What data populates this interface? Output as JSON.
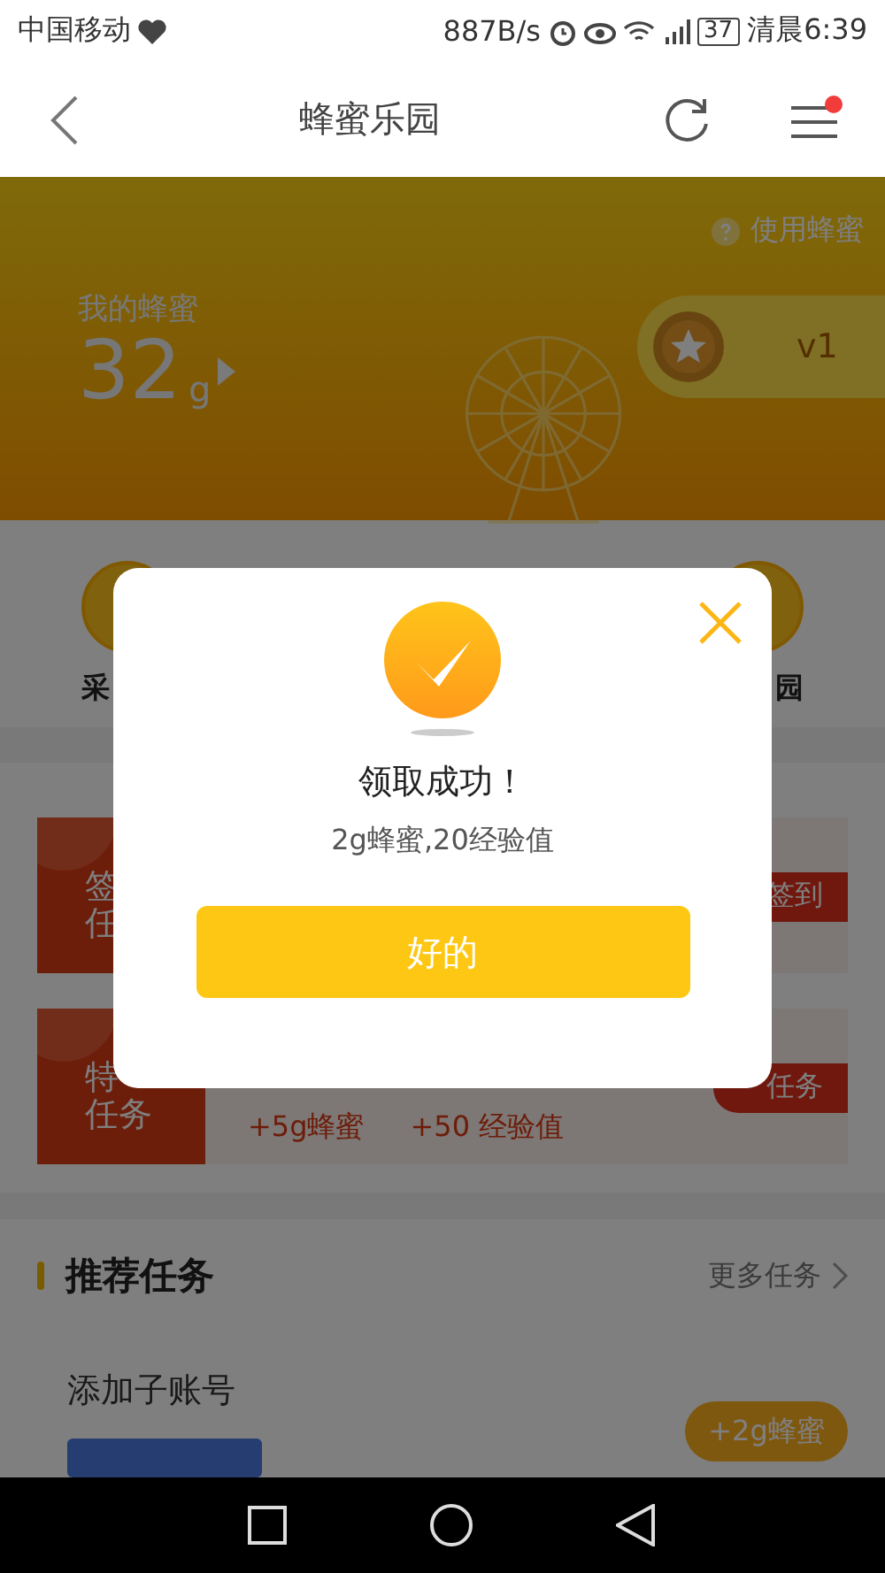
{
  "status_bar": {
    "carrier": "中国移动",
    "speed": "887B/s",
    "battery": "37",
    "time": "清晨6:39"
  },
  "nav": {
    "title": "蜂蜜乐园",
    "menu_badge": true
  },
  "header": {
    "help_link": "使用蜂蜜",
    "label": "我的蜂蜜",
    "amount": "32",
    "unit": "g",
    "level": "v1"
  },
  "shortcuts": [
    {
      "label": "采"
    },
    {
      "label": "园"
    }
  ],
  "tasks": [
    {
      "tag_lines": [
        "签",
        "任"
      ],
      "button": "签到"
    },
    {
      "tag_lines": [
        "特",
        "任务"
      ],
      "rewards": [
        "+5g蜂蜜",
        "+50 经验值"
      ],
      "button": "任务"
    }
  ],
  "recommend": {
    "title": "推荐任务",
    "more": "更多任务",
    "items": [
      {
        "name": "添加子账号",
        "reward": "+2g蜂蜜"
      }
    ]
  },
  "dialog": {
    "title": "领取成功！",
    "message": "2g蜂蜜,20经验值",
    "button": "好的"
  }
}
